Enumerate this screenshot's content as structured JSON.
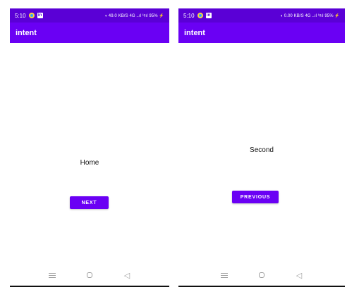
{
  "left_screen": {
    "status": {
      "time": "5:10",
      "right": "◖ 49.0 KB/S 4G ..ıl ¹ᵍıl 95% ⚡"
    },
    "app_bar_title": "intent",
    "content_text": "Home",
    "button_label": "NEXT"
  },
  "right_screen": {
    "status": {
      "time": "5:10",
      "right": "◖ 0.00 KB/S 4G ..ıl ¹ᵍıl 95% ⚡"
    },
    "app_bar_title": "intent",
    "content_text": "Second",
    "button_label": "PREVIOUS"
  },
  "colors": {
    "status_bar": "#5a00d6",
    "app_bar": "#6a00f4",
    "button": "#6a00f4",
    "nav_icons": "#9e9e9e"
  },
  "icons": [
    "notification-dot-icon",
    "linkedin-icon",
    "menu-icon",
    "home-icon",
    "back-icon"
  ]
}
